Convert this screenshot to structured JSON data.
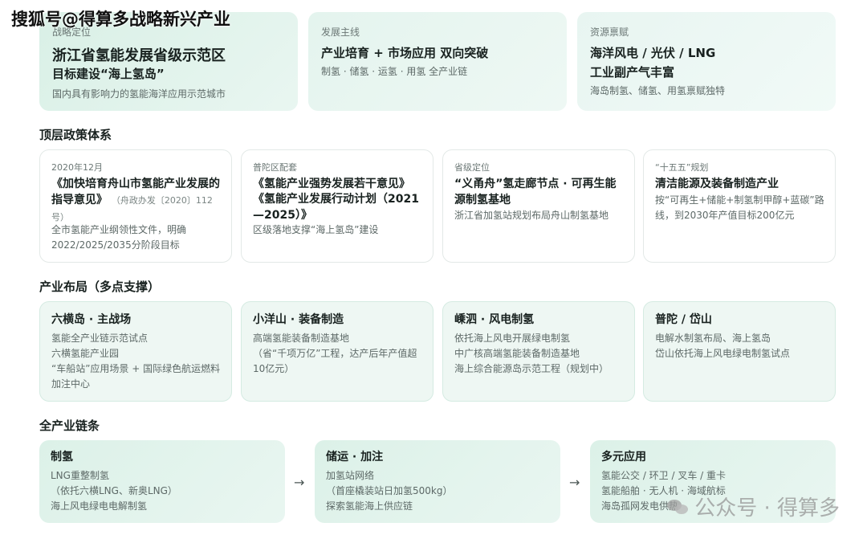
{
  "watermark_top": "搜狐号@得算多战略新兴产业",
  "top_cards": [
    {
      "label": "战略定位",
      "title": "浙江省氢能发展省级示范区",
      "subtitle": "目标建设“海上氢岛”",
      "desc": "国内具有影响力的氢能海洋应用示范城市"
    },
    {
      "label": "发展主线",
      "title": "产业培育 + 市场应用 双向突破",
      "desc": "制氢 · 储氢 · 运氢 · 用氢 全产业链"
    },
    {
      "label": "资源禀赋",
      "title": "海洋风电 / 光伏 / LNG",
      "subtitle": "工业副产气丰富",
      "desc": "海岛制氢、储氢、用氢禀赋独特"
    }
  ],
  "sections": {
    "policy": "顶层政策体系",
    "layout": "产业布局（多点支撑）",
    "chain": "全产业链条"
  },
  "policy_cards": [
    {
      "label": "2020年12月",
      "title": "《加快培育舟山市氢能产业发展的指导意见》",
      "note": "（舟政办发〔2020〕112号）",
      "desc1": "全市氢能产业纲领性文件，明确",
      "desc2": "2022/2025/2035分阶段目标"
    },
    {
      "label": "普陀区配套",
      "title1": "《氢能产业强势发展若干意见》",
      "title2": "《氢能产业发展行动计划（2021—2025）》",
      "desc1": "区级落地支撑“海上氢岛”建设"
    },
    {
      "label": "省级定位",
      "title": "“义甬舟”氢走廊节点 · 可再生能源制氢基地",
      "desc1": "浙江省加氢站规划布局舟山制氢基地"
    },
    {
      "label": "“十五五”规划",
      "title": "清洁能源及装备制造产业",
      "desc1": "按“可再生+储能+制氢制甲醇+蓝碳”路",
      "desc2": "线，到2030年产值目标200亿元"
    }
  ],
  "layout_cards": [
    {
      "title": "六横岛 · 主战场",
      "lines": [
        "氢能全产业链示范试点",
        "六横氢能产业园",
        "“车船站”应用场景 + 国际绿色航运燃料",
        "加注中心"
      ]
    },
    {
      "title": "小洋山 · 装备制造",
      "lines": [
        "高端氢能装备制造基地",
        "（省“千项万亿”工程，达产后年产值超",
        "10亿元）"
      ]
    },
    {
      "title": "嵊泗 · 风电制氢",
      "lines": [
        "依托海上风电开展绿电制氢",
        "中广核高端氢能装备制造基地",
        "海上综合能源岛示范工程（规划中）"
      ]
    },
    {
      "title": "普陀 / 岱山",
      "lines": [
        "电解水制氢布局、海上氢岛",
        "岱山依托海上风电绿电制氢试点"
      ]
    }
  ],
  "chain_cards": [
    {
      "title": "制氢",
      "lines": [
        "LNG重整制氢",
        "（依托六横LNG、新奥LNG）",
        "海上风电绿电电解制氢"
      ]
    },
    {
      "title": "储运 · 加注",
      "lines": [
        "加氢站网络",
        "（首座橇装站日加氢500kg）",
        "探索氢能海上供应链"
      ]
    },
    {
      "title": "多元应用",
      "lines": [
        "氢能公交 / 环卫 / 叉车 / 重卡",
        "氢能船舶 · 无人机 · 海域航标",
        "海岛孤网发电供热"
      ]
    }
  ],
  "arrow": "→",
  "watermark_bottom": "公众号 · 得算多"
}
